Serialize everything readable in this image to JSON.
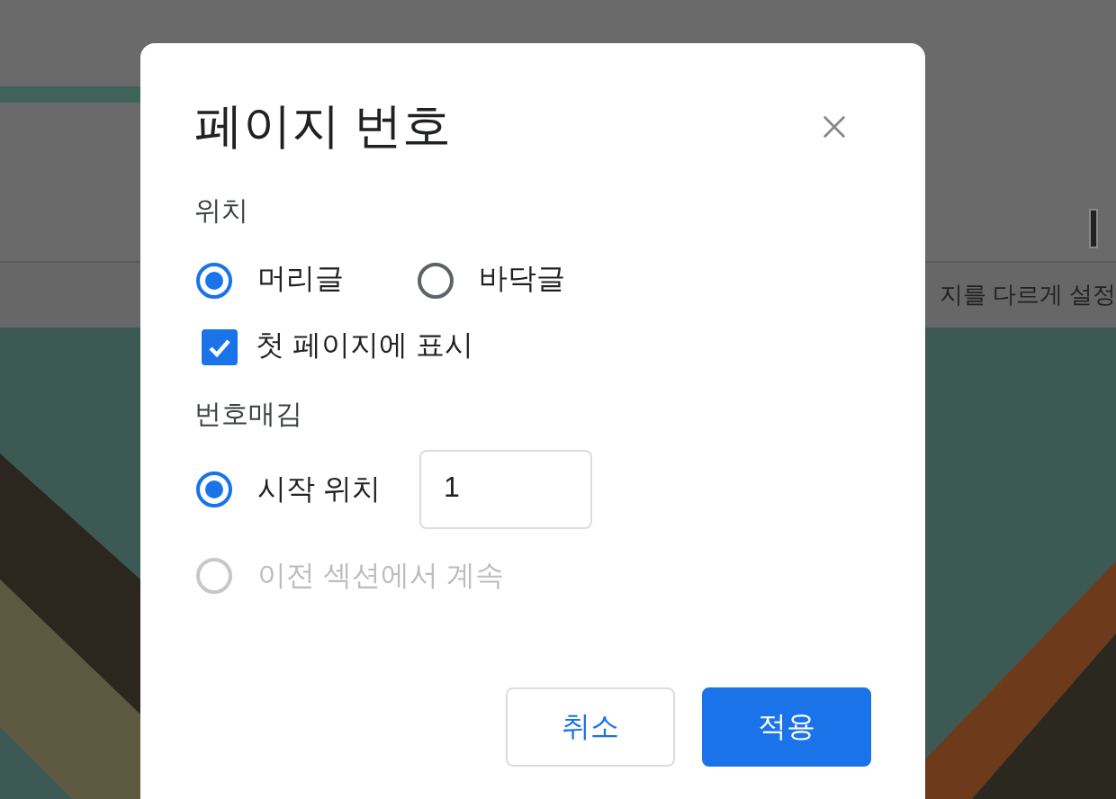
{
  "background": {
    "toolbar_text": "지를 다르게 설정"
  },
  "dialog": {
    "title": "페이지 번호",
    "position": {
      "label": "위치",
      "options": [
        {
          "label": "머리글",
          "selected": true
        },
        {
          "label": "바닥글",
          "selected": false
        }
      ]
    },
    "first_page": {
      "label": "첫 페이지에 표시",
      "checked": true
    },
    "numbering": {
      "label": "번호매김",
      "start_value": "1",
      "options": [
        {
          "label": "시작 위치",
          "selected": true,
          "disabled": false,
          "kind": "start"
        },
        {
          "label": "이전 섹션에서 계속",
          "selected": false,
          "disabled": true,
          "kind": "plain"
        }
      ]
    },
    "buttons": [
      {
        "label": "취소",
        "kind": "secondary"
      },
      {
        "label": "적용",
        "kind": "primary"
      }
    ]
  }
}
